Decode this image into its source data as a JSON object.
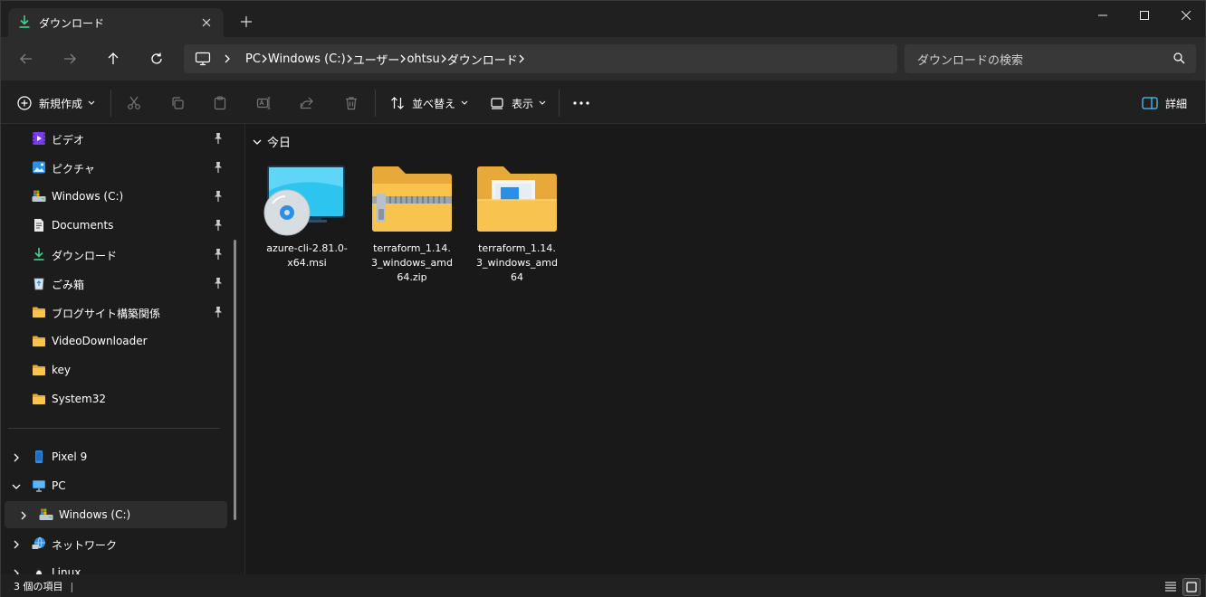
{
  "tab": {
    "title": "ダウンロード",
    "icon": "download-icon"
  },
  "address": {
    "crumbs": [
      "PC",
      "Windows (C:)",
      "ユーザー",
      "ohtsu",
      "ダウンロード"
    ]
  },
  "search": {
    "placeholder": "ダウンロードの検索"
  },
  "commands": {
    "new": "新規作成",
    "sort": "並べ替え",
    "view": "表示",
    "details": "詳細"
  },
  "sidebar": {
    "pinned": [
      {
        "label": "ビデオ",
        "icon": "videos-icon"
      },
      {
        "label": "ピクチャ",
        "icon": "pictures-icon"
      },
      {
        "label": "Windows (C:)",
        "icon": "drive-icon"
      },
      {
        "label": "Documents",
        "icon": "document-icon"
      },
      {
        "label": "ダウンロード",
        "icon": "download-icon"
      },
      {
        "label": "ごみ箱",
        "icon": "recycle-bin-icon"
      },
      {
        "label": "ブログサイト構築関係",
        "icon": "folder-icon"
      }
    ],
    "folders": [
      {
        "label": "VideoDownloader",
        "icon": "folder-icon"
      },
      {
        "label": "key",
        "icon": "folder-icon"
      },
      {
        "label": "System32",
        "icon": "folder-icon"
      }
    ],
    "devices": [
      {
        "label": "Pixel 9",
        "icon": "phone-icon"
      },
      {
        "label": "PC",
        "icon": "pc-icon"
      },
      {
        "label": "Windows (C:)",
        "icon": "drive-icon"
      },
      {
        "label": "ネットワーク",
        "icon": "network-icon"
      },
      {
        "label": "Linux",
        "icon": "linux-icon"
      }
    ]
  },
  "content": {
    "group": "今日",
    "files": [
      {
        "name": "azure-cli-2.81.0-x64.msi",
        "icon": "msi-installer-icon"
      },
      {
        "name": "terraform_1.14.3_windows_amd64.zip",
        "icon": "zip-folder-icon"
      },
      {
        "name": "terraform_1.14.3_windows_amd64",
        "icon": "folder-icon"
      }
    ]
  },
  "status": {
    "text": "3 個の項目"
  },
  "colors": {
    "accent": "#4cc2ff",
    "folder": "#f8c44e",
    "download": "#3fd08c"
  }
}
